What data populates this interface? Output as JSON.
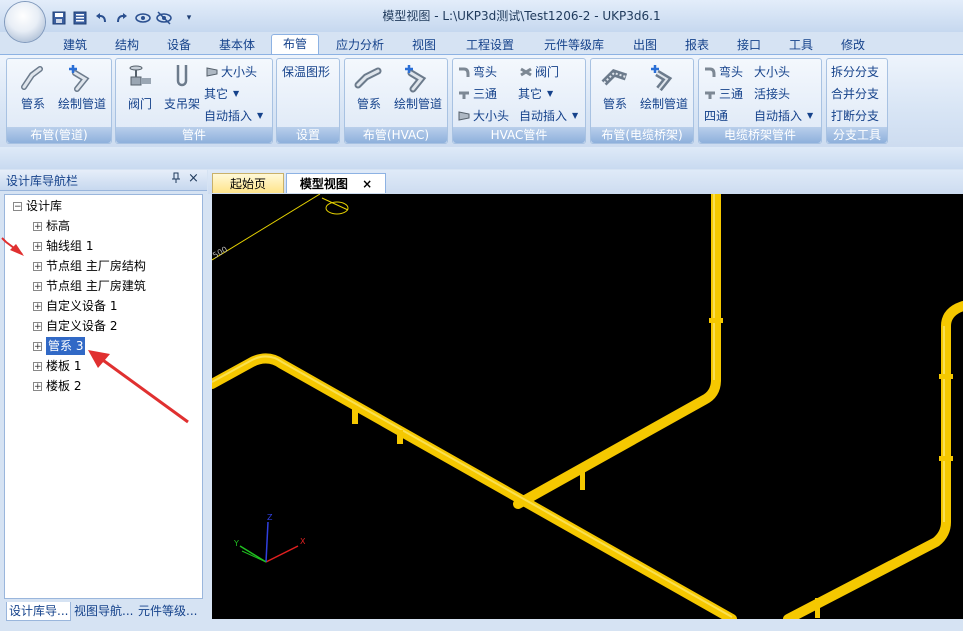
{
  "window": {
    "title": "模型视图 - L:\\UKP3d测试\\Test1206-2 - UKP3d6.1"
  },
  "quick_access": {
    "icons": [
      "save-icon",
      "save-all-icon",
      "undo-icon",
      "redo-icon",
      "eye-icon",
      "eye-hide-icon",
      "dropdown-icon"
    ]
  },
  "menu_tabs": [
    {
      "label": "建筑"
    },
    {
      "label": "结构"
    },
    {
      "label": "设备"
    },
    {
      "label": "基本体"
    },
    {
      "label": "布管",
      "active": true
    },
    {
      "label": "应力分析"
    },
    {
      "label": "视图"
    },
    {
      "label": "工程设置"
    },
    {
      "label": "元件等级库"
    },
    {
      "label": "出图"
    },
    {
      "label": "报表"
    },
    {
      "label": "接口"
    },
    {
      "label": "工具"
    },
    {
      "label": "修改"
    }
  ],
  "ribbon": {
    "g1": {
      "label": "布管(管道)",
      "btn1": "管系",
      "btn2": "绘制管道"
    },
    "g2": {
      "label": "管件",
      "btn1": "阀门",
      "btn2": "支吊架",
      "s1": "大小头",
      "s2": "其它",
      "s3": "自动插入"
    },
    "g3": {
      "label": "设置",
      "btn1": "保温图形"
    },
    "g4": {
      "label": "布管(HVAC)",
      "btn1": "管系",
      "btn2": "绘制管道"
    },
    "g5": {
      "label": "HVAC管件",
      "s1": "弯头",
      "s2": "阀门",
      "s3": "三通",
      "s4": "其它",
      "s5": "大小头",
      "s6": "自动插入"
    },
    "g6": {
      "label": "布管(电缆桥架)",
      "btn1": "管系",
      "btn2": "绘制管道"
    },
    "g7": {
      "label": "电缆桥架管件",
      "s1": "弯头",
      "s2": "大小头",
      "s3": "三通",
      "s4": "活接头",
      "s5": "四通",
      "s6": "自动插入"
    },
    "g8": {
      "label": "分支工具",
      "s1": "拆分分支",
      "s2": "合并分支",
      "s3": "打断分支"
    }
  },
  "left_panel": {
    "title": "设计库导航栏",
    "pin": "ᅟ",
    "close": "×",
    "root": "设计库",
    "items": [
      {
        "label": "标高"
      },
      {
        "label": "轴线组 1"
      },
      {
        "label": "节点组 主厂房结构"
      },
      {
        "label": "节点组 主厂房建筑"
      },
      {
        "label": "自定义设备 1"
      },
      {
        "label": "自定义设备 2"
      },
      {
        "label": "管系 3",
        "selected": true
      },
      {
        "label": "楼板 1"
      },
      {
        "label": "楼板 2"
      }
    ],
    "bottom_tabs": [
      {
        "label": "设计库导...",
        "active": true
      },
      {
        "label": "视图导航..."
      },
      {
        "label": "元件等级..."
      }
    ]
  },
  "doc_tabs": {
    "tab1": "起始页",
    "tab2": "模型视图",
    "close": "×"
  },
  "viewport": {
    "label_500": "500",
    "axis_x": "X",
    "axis_y": "Y",
    "axis_z": "Z",
    "pipe_color": "#f5c800",
    "annotation_arrow_color": "#e03030"
  }
}
